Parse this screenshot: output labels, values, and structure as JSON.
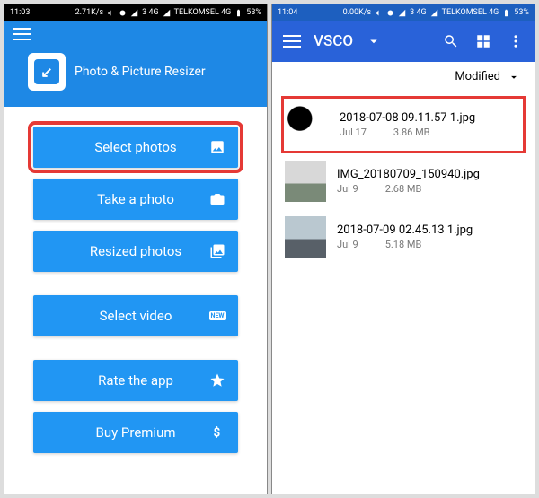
{
  "left": {
    "statusbar": {
      "time": "11:03",
      "net_speed": "2.71K/s",
      "sim_label": "3 4G",
      "carrier": "TELKOMSEL 4G",
      "battery": "53%"
    },
    "app_title": "Photo & Picture Resizer",
    "buttons": {
      "select_photos": "Select photos",
      "take_photo": "Take a photo",
      "resized_photos": "Resized photos",
      "select_video": "Select video",
      "rate_app": "Rate the app",
      "buy_premium": "Buy Premium"
    }
  },
  "right": {
    "statusbar": {
      "time": "11:04",
      "net_speed": "0.00K/s",
      "sim_label": "3 4G",
      "carrier": "TELKOMSEL 4G",
      "battery": "53%"
    },
    "appbar": {
      "title": "VSCO"
    },
    "sort_label": "Modified",
    "files": [
      {
        "name": "2018-07-08 09.11.57 1.jpg",
        "date": "Jul 17",
        "size": "3.86 MB"
      },
      {
        "name": "IMG_20180709_150940.jpg",
        "date": "Jul 9",
        "size": "2.68 MB"
      },
      {
        "name": "2018-07-09 02.45.13 1.jpg",
        "date": "Jul 9",
        "size": "5.18 MB"
      }
    ]
  }
}
